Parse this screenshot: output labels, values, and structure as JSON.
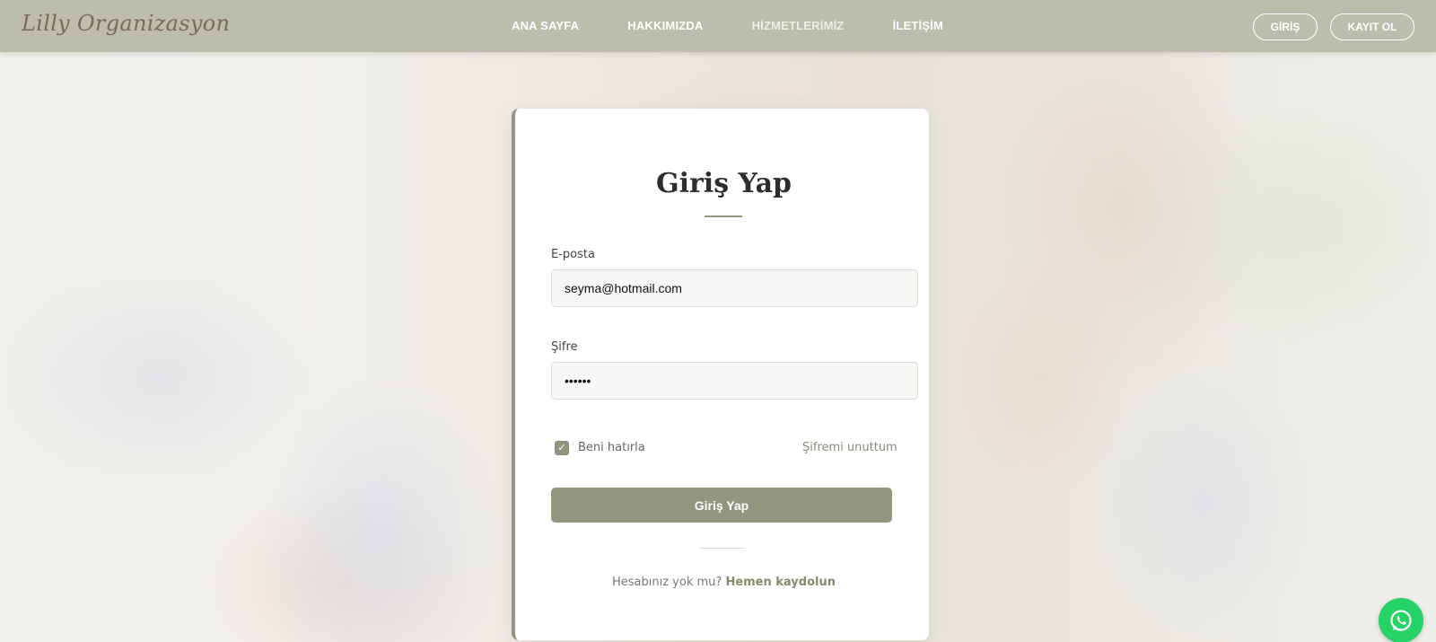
{
  "header": {
    "logo": "Lilly Organizasyon",
    "nav": [
      "ANA SAYFA",
      "HAKKIMIZDA",
      "HİZMETLERİMİZ",
      "İLETİŞİM"
    ],
    "login_button": "GİRİŞ",
    "register_button": "KAYIT OL"
  },
  "form": {
    "title": "Giriş Yap",
    "email_label": "E-posta",
    "email_value": "seyma@hotmail.com",
    "password_label": "Şifre",
    "password_value": "••••••",
    "remember_checked": true,
    "remember_label": "Beni hatırla",
    "forgot_link": "Şifremi unuttum",
    "submit_label": "Giriş Yap",
    "signup_prompt": "Hesabınız yok mu?",
    "signup_link": "Hemen kaydolun"
  },
  "icons": {
    "whatsapp": "whatsapp-icon",
    "checkbox": "checkmark-icon"
  },
  "colors": {
    "header_bg": "#bcbdac",
    "accent": "#93957f",
    "whatsapp_green": "#25d366"
  }
}
